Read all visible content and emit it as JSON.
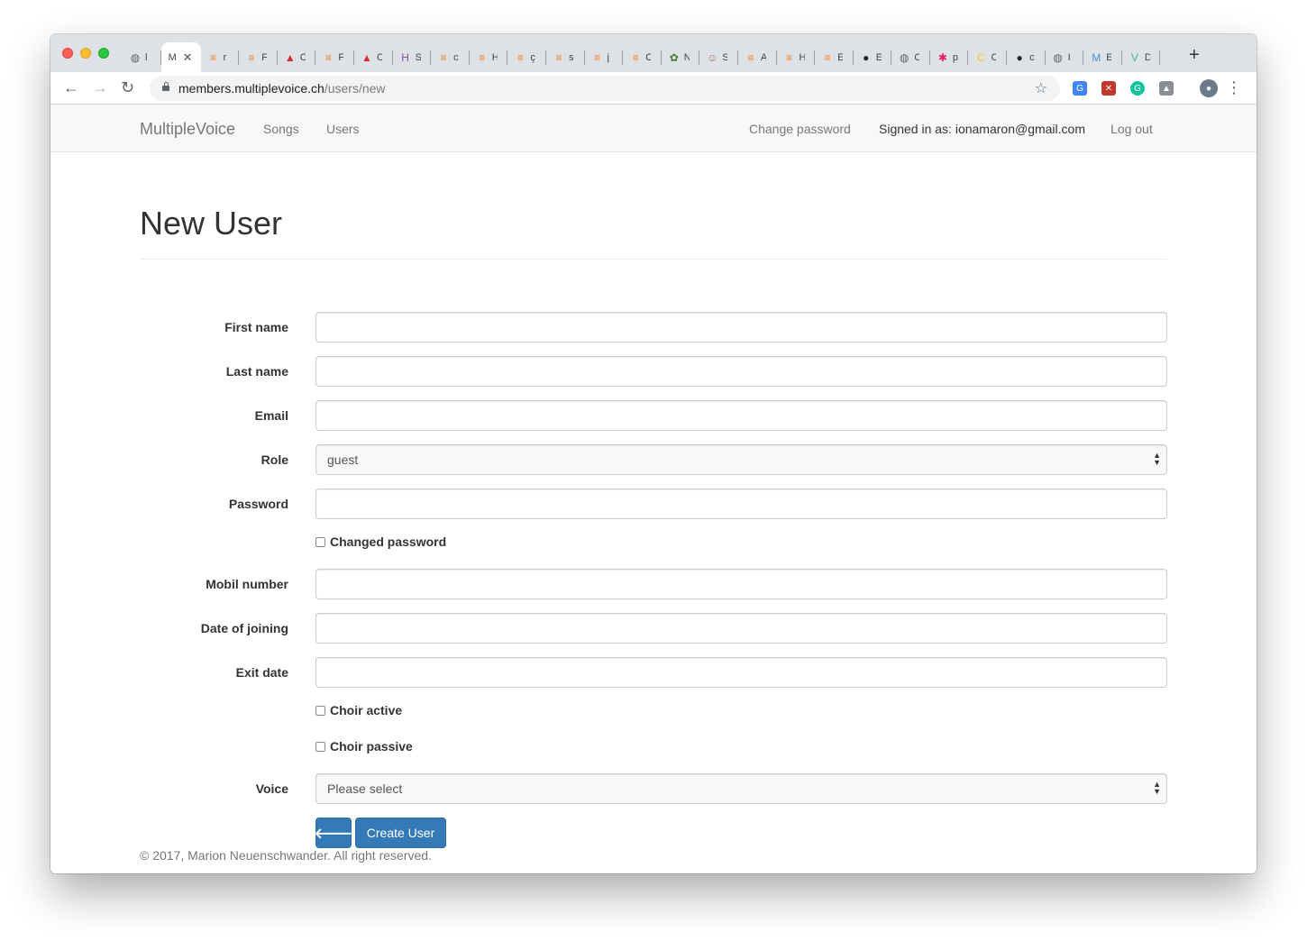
{
  "browser": {
    "tabs": [
      {
        "icon": "globe-icon",
        "color": "#5f6368",
        "glyph": "◍",
        "title": "l"
      },
      {
        "icon": "globe-icon",
        "color": "#5f6368",
        "glyph": "",
        "title": "M",
        "active": true
      },
      {
        "icon": "stackoverflow-icon",
        "color": "#f48024",
        "glyph": "≡",
        "title": "r"
      },
      {
        "icon": "stackoverflow-icon",
        "color": "#f48024",
        "glyph": "≡",
        "title": "F"
      },
      {
        "icon": "red-shoe-icon",
        "color": "#d32f2f",
        "glyph": "▲",
        "title": "C"
      },
      {
        "icon": "stackoverflow-icon",
        "color": "#f48024",
        "glyph": "≡",
        "title": "F"
      },
      {
        "icon": "red-shoe-icon",
        "color": "#d32f2f",
        "glyph": "▲",
        "title": "C"
      },
      {
        "icon": "heroku-icon",
        "color": "#79589f",
        "glyph": "H",
        "title": "S"
      },
      {
        "icon": "stackoverflow-icon",
        "color": "#f48024",
        "glyph": "≡",
        "title": "c"
      },
      {
        "icon": "stackoverflow-icon",
        "color": "#f48024",
        "glyph": "≡",
        "title": "H"
      },
      {
        "icon": "stackoverflow-icon",
        "color": "#f48024",
        "glyph": "≡",
        "title": "ç"
      },
      {
        "icon": "stackoverflow-icon",
        "color": "#f48024",
        "glyph": "≡",
        "title": "s"
      },
      {
        "icon": "stackoverflow-icon",
        "color": "#f48024",
        "glyph": "≡",
        "title": "j"
      },
      {
        "icon": "stackoverflow-icon",
        "color": "#f48024",
        "glyph": "≡",
        "title": "C"
      },
      {
        "icon": "tree-icon",
        "color": "#4a7a3a",
        "glyph": "✿",
        "title": "N"
      },
      {
        "icon": "portrait-icon",
        "color": "#a0785a",
        "glyph": "☺",
        "title": "S"
      },
      {
        "icon": "stackoverflow-icon",
        "color": "#f48024",
        "glyph": "≡",
        "title": "A"
      },
      {
        "icon": "stackoverflow-icon",
        "color": "#f48024",
        "glyph": "≡",
        "title": "H"
      },
      {
        "icon": "stackoverflow-icon",
        "color": "#f48024",
        "glyph": "≡",
        "title": "E"
      },
      {
        "icon": "github-icon",
        "color": "#24292e",
        "glyph": "●",
        "title": "E"
      },
      {
        "icon": "globe-icon",
        "color": "#5f6368",
        "glyph": "◍",
        "title": "C"
      },
      {
        "icon": "asterisk-icon",
        "color": "#e91e63",
        "glyph": "✱",
        "title": "p"
      },
      {
        "icon": "cc-icon",
        "color": "#f5c518",
        "glyph": "C",
        "title": "C"
      },
      {
        "icon": "github-icon",
        "color": "#24292e",
        "glyph": "●",
        "title": "c"
      },
      {
        "icon": "globe-icon",
        "color": "#5f6368",
        "glyph": "◍",
        "title": "I"
      },
      {
        "icon": "mdb-icon",
        "color": "#4a90d9",
        "glyph": "M",
        "title": "E"
      },
      {
        "icon": "vue-icon",
        "color": "#41b883",
        "glyph": "V",
        "title": "D"
      }
    ],
    "url_host": "members.multiplevoice.ch",
    "url_path": "/users/new",
    "accent": "#337ab7"
  },
  "nav": {
    "brand": "MultipleVoice",
    "songs": "Songs",
    "users": "Users",
    "change_password": "Change password",
    "signed_in": "Signed in as: ionamaron@gmail.com",
    "logout": "Log out"
  },
  "form": {
    "title": "New User",
    "first_name": {
      "label": "First name",
      "value": ""
    },
    "last_name": {
      "label": "Last name",
      "value": ""
    },
    "email": {
      "label": "Email",
      "value": ""
    },
    "role": {
      "label": "Role",
      "value": "guest"
    },
    "password": {
      "label": "Password",
      "value": ""
    },
    "changed_password": {
      "label": "Changed password",
      "checked": false
    },
    "mobile": {
      "label": "Mobil number",
      "value": ""
    },
    "joining": {
      "label": "Date of joining",
      "value": ""
    },
    "exit": {
      "label": "Exit date",
      "value": ""
    },
    "choir_active": {
      "label": "Choir active",
      "checked": false
    },
    "choir_passive": {
      "label": "Choir passive",
      "checked": false
    },
    "voice": {
      "label": "Voice",
      "value": "Please select"
    },
    "back_icon": "arrow-left-icon",
    "create_label": "Create User"
  },
  "footer": {
    "text": "© 2017, Marion Neuenschwander. All right reserved."
  }
}
